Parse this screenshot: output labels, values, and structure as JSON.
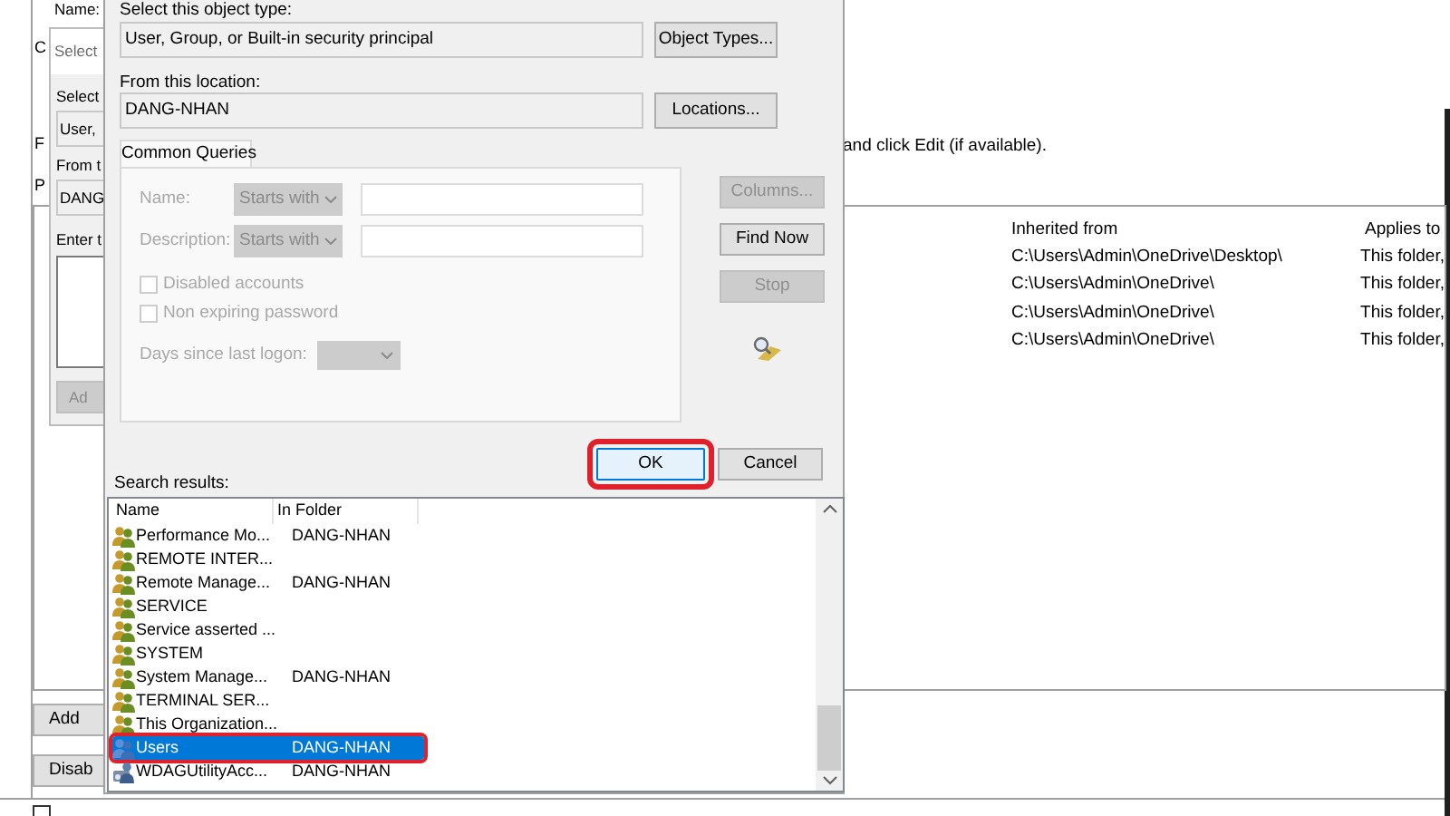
{
  "background_window": {
    "name_label": "Name:",
    "letters": [
      "C",
      "F",
      "P"
    ],
    "instruction": "and click Edit (if available).",
    "columns": [
      "Inherited from",
      "Applies to"
    ],
    "rows": [
      {
        "inherited_from": "C:\\Users\\Admin\\OneDrive\\Desktop\\",
        "applies_to": "This folder,"
      },
      {
        "inherited_from": "C:\\Users\\Admin\\OneDrive\\",
        "applies_to": "This folder,"
      },
      {
        "inherited_from": "C:\\Users\\Admin\\OneDrive\\",
        "applies_to": "This folder,"
      },
      {
        "inherited_from": "C:\\Users\\Admin\\OneDrive\\",
        "applies_to": "This folder,"
      }
    ],
    "buttons": [
      "Add",
      "Disab"
    ],
    "replace_checkbox": {
      "checked": false
    }
  },
  "middle_dialog": {
    "title": "Select",
    "object_type_label": "Select",
    "object_type_value": "User,",
    "location_label": "From t",
    "location_value": "DANG",
    "names_label": "Enter t",
    "add_button": {
      "label": "Ad",
      "disabled": true
    }
  },
  "dialog": {
    "object_type_label": "Select this object type:",
    "object_type_value": "User, Group, or Built-in security principal",
    "object_types_button": "Object Types...",
    "location_label": "From this location:",
    "location_value": "DANG-NHAN",
    "locations_button": "Locations...",
    "tab": {
      "label": "Common Queries",
      "selected": true
    },
    "queries": [
      {
        "label": "Name:",
        "operator": "Starts with",
        "disabled": true
      },
      {
        "label": "Description:",
        "operator": "Starts with",
        "disabled": true
      }
    ],
    "checkboxes": [
      {
        "label": "Disabled accounts",
        "checked": false,
        "disabled": true
      },
      {
        "label": "Non expiring password",
        "checked": false,
        "disabled": true
      }
    ],
    "days_label": "Days since last logon:",
    "side_buttons": [
      {
        "label": "Columns...",
        "disabled": true
      },
      {
        "label": "Find Now",
        "disabled": false
      },
      {
        "label": "Stop",
        "disabled": true
      }
    ],
    "ok_button": {
      "label": "OK",
      "highlighted": true
    },
    "cancel_button": {
      "label": "Cancel",
      "highlighted": false
    },
    "results_label": "Search results:",
    "results_columns": [
      "Name",
      "In Folder"
    ],
    "results": [
      {
        "name": "Performance Mo...",
        "folder": "DANG-NHAN",
        "kind": "group",
        "selected": false,
        "highlighted": false
      },
      {
        "name": "REMOTE INTER...",
        "kind": "group",
        "selected": false,
        "highlighted": false
      },
      {
        "name": "Remote Manage...",
        "folder": "DANG-NHAN",
        "kind": "group",
        "selected": false,
        "highlighted": false
      },
      {
        "name": "SERVICE",
        "kind": "group",
        "selected": false,
        "highlighted": false
      },
      {
        "name": "Service asserted ...",
        "kind": "group",
        "selected": false,
        "highlighted": false
      },
      {
        "name": "SYSTEM",
        "kind": "group",
        "selected": false,
        "highlighted": false
      },
      {
        "name": "System Manage...",
        "folder": "DANG-NHAN",
        "kind": "group",
        "selected": false,
        "highlighted": false
      },
      {
        "name": "TERMINAL SER...",
        "kind": "group",
        "selected": false,
        "highlighted": false
      },
      {
        "name": "This Organization...",
        "kind": "group",
        "selected": false,
        "highlighted": false
      },
      {
        "name": "Users",
        "folder": "DANG-NHAN",
        "kind": "group",
        "selected": true,
        "highlighted": true
      },
      {
        "name": "WDAGUtilityAcc...",
        "folder": "DANG-NHAN",
        "kind": "account",
        "selected": false,
        "highlighted": false
      }
    ]
  }
}
